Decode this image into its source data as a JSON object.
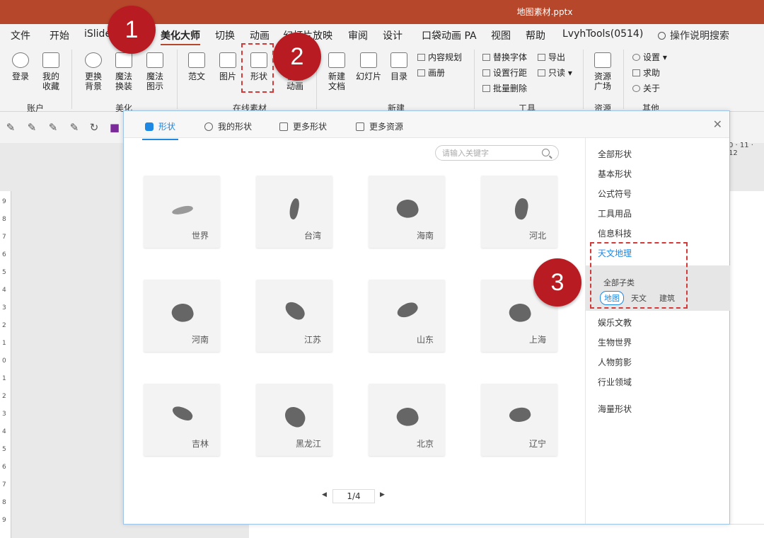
{
  "window": {
    "title": "地图素材.pptx"
  },
  "ribbon_tabs": [
    "文件",
    "开始",
    "iSlide",
    "美化大师",
    "切换",
    "动画",
    "幻灯片放映",
    "审阅",
    "设计",
    "口袋动画 PA",
    "视图",
    "帮助",
    "LvyhTools(0514)"
  ],
  "active_tab": "美化大师",
  "help_search": "操作说明搜索",
  "ribbon": {
    "login": "登录",
    "favorites": "我的\n收藏",
    "replace_bg": "更换\n背景",
    "magic_change": "魔法\n换装",
    "magic_diagram": "魔法\n图示",
    "template": "范文",
    "picture": "图片",
    "shape": "形状",
    "online_anim": "在线\n动画",
    "new_doc": "新建\n文档",
    "slides": "幻灯片",
    "toc": "目录",
    "content_plan": "内容规划",
    "album": "画册",
    "replace_font": "替换字体",
    "export": "导出",
    "line_spacing": "设置行距",
    "readonly": "只读",
    "batch_delete": "批量删除",
    "resource_plaza": "资源\n广场",
    "settings": "设置",
    "help": "求助",
    "about": "关于",
    "group_account": "账户",
    "group_beautify": "美化",
    "group_online": "在线素材",
    "group_new": "新建",
    "group_tools": "工具",
    "group_resource": "资源",
    "group_other": "其他"
  },
  "ruler_top": "0 · 11 · 12",
  "ruler_left": [
    "9",
    "8",
    "7",
    "6",
    "5",
    "4",
    "3",
    "2",
    "1",
    "0",
    "1",
    "2",
    "3",
    "4",
    "5",
    "6",
    "7",
    "8",
    "9"
  ],
  "dialog": {
    "tabs": [
      "形状",
      "我的形状",
      "更多形状",
      "更多资源"
    ],
    "active_tab": "形状",
    "search_placeholder": "请输入关键字",
    "items": [
      "世界",
      "台湾",
      "海南",
      "河北",
      "河南",
      "江苏",
      "山东",
      "上海",
      "吉林",
      "黑龙江",
      "北京",
      "辽宁"
    ],
    "page": "1/4",
    "categories": [
      "全部形状",
      "基本形状",
      "公式符号",
      "工具用品",
      "信息科技",
      "天文地理",
      "娱乐文教",
      "生物世界",
      "人物剪影",
      "行业领域",
      "海量形状"
    ],
    "active_category": "天文地理",
    "subcategory_title": "全部子类",
    "subcategories": [
      "地图",
      "天文",
      "建筑"
    ],
    "active_subcategory": "地图"
  },
  "annotations": [
    "1",
    "2",
    "3"
  ],
  "colors": {
    "brand": "#b7472a",
    "accent": "#1e88e5",
    "badge": "#b81c22"
  }
}
